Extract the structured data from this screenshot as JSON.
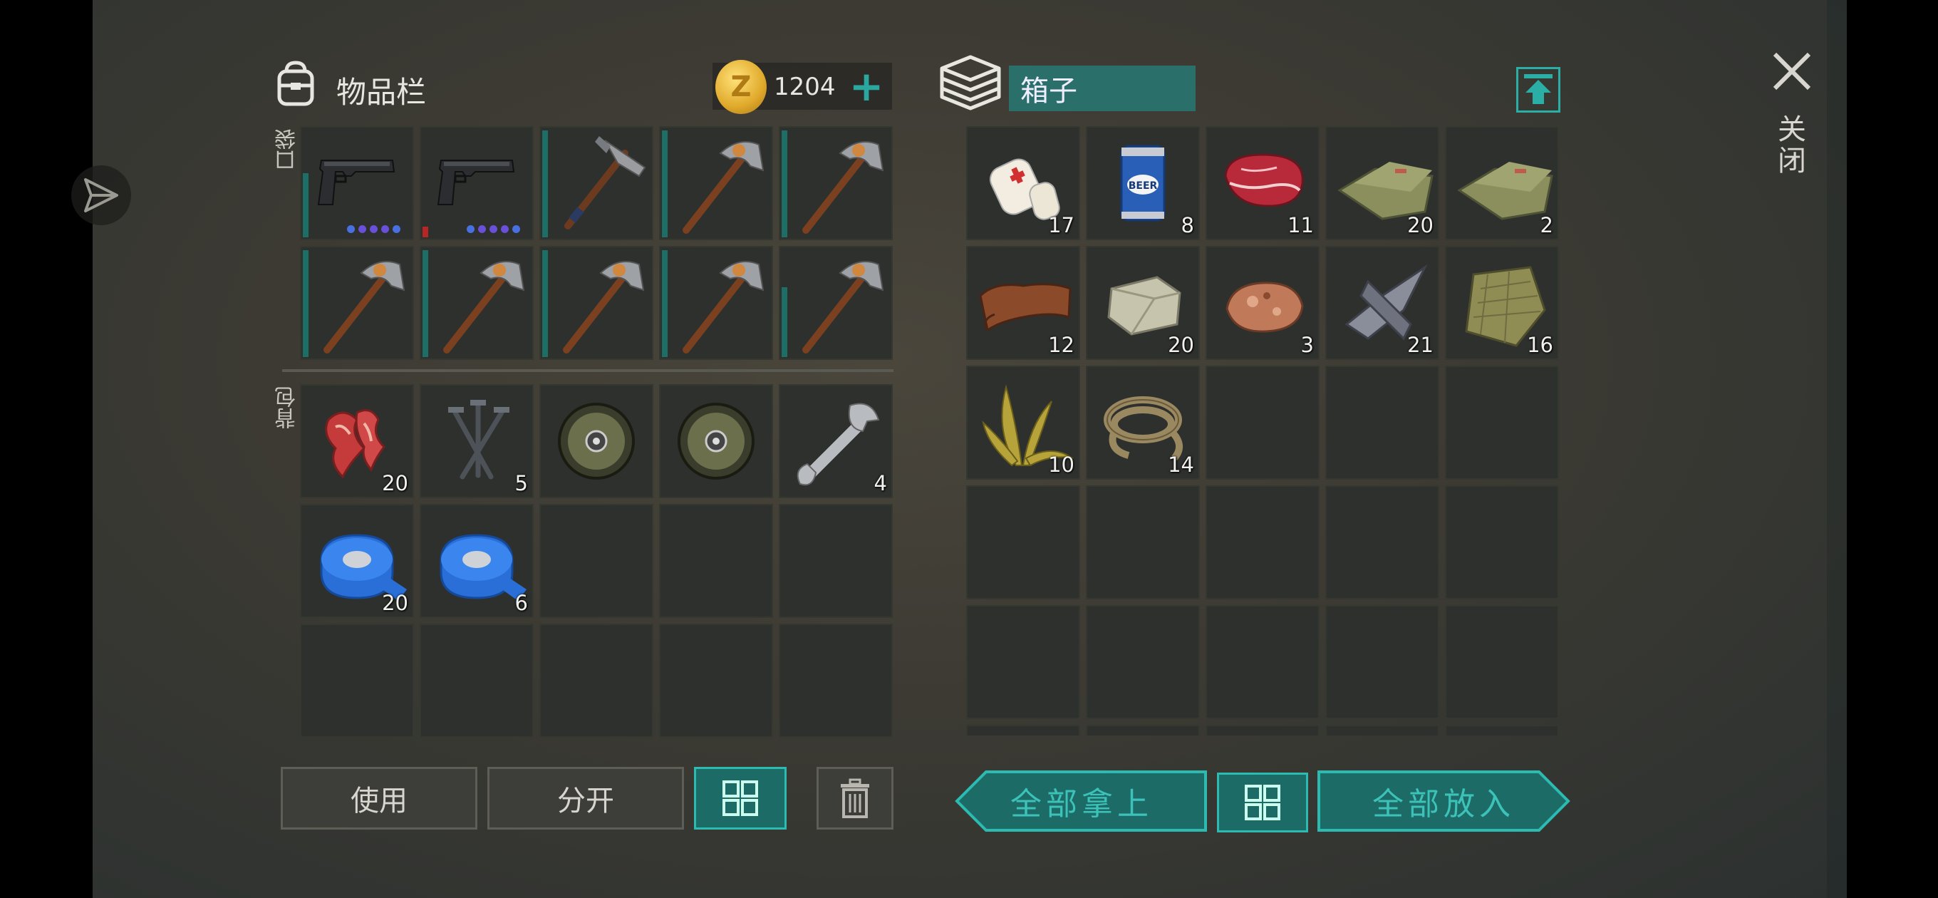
{
  "inventory": {
    "title": "物品栏",
    "coins": "1204",
    "coin_symbol": "Z",
    "add_label": "+",
    "pockets_label": "口袋",
    "backpack_label": "背包",
    "pocket_slots": [
      {
        "item": "pistol",
        "count": "",
        "dura": 0.6,
        "dura_color": "teal",
        "dots": true
      },
      {
        "item": "pistol",
        "count": "",
        "dura": 0.1,
        "dura_color": "red",
        "dots": true
      },
      {
        "item": "axe",
        "count": "",
        "dura": 1.0,
        "dura_color": "teal"
      },
      {
        "item": "pickaxe",
        "count": "",
        "dura": 1.0,
        "dura_color": "teal"
      },
      {
        "item": "pickaxe",
        "count": "",
        "dura": 1.0,
        "dura_color": "teal"
      },
      {
        "item": "pickaxe",
        "count": "",
        "dura": 1.0,
        "dura_color": "teal"
      },
      {
        "item": "pickaxe",
        "count": "",
        "dura": 1.0,
        "dura_color": "teal"
      },
      {
        "item": "pickaxe",
        "count": "",
        "dura": 1.0,
        "dura_color": "teal"
      },
      {
        "item": "pickaxe",
        "count": "",
        "dura": 1.0,
        "dura_color": "teal"
      },
      {
        "item": "pickaxe",
        "count": "",
        "dura": 0.65,
        "dura_color": "teal"
      }
    ],
    "backpack_slots": [
      {
        "item": "bacon",
        "count": "20"
      },
      {
        "item": "nails",
        "count": "5"
      },
      {
        "item": "wheel",
        "count": ""
      },
      {
        "item": "wheel",
        "count": ""
      },
      {
        "item": "wrench",
        "count": "4"
      },
      {
        "item": "tape",
        "count": "20"
      },
      {
        "item": "tape",
        "count": "6"
      },
      {
        "item": "",
        "count": ""
      },
      {
        "item": "",
        "count": ""
      },
      {
        "item": "",
        "count": ""
      },
      {
        "item": "",
        "count": ""
      },
      {
        "item": "",
        "count": ""
      },
      {
        "item": "",
        "count": ""
      },
      {
        "item": "",
        "count": ""
      },
      {
        "item": "",
        "count": ""
      }
    ],
    "buttons": {
      "use": "使用",
      "split": "分开"
    }
  },
  "box": {
    "name": "箱子",
    "slots": [
      {
        "item": "bandage",
        "count": "17"
      },
      {
        "item": "beer",
        "count": "8"
      },
      {
        "item": "steak",
        "count": "11"
      },
      {
        "item": "cloth",
        "count": "20"
      },
      {
        "item": "cloth",
        "count": "2"
      },
      {
        "item": "leather",
        "count": "12"
      },
      {
        "item": "stone",
        "count": "20"
      },
      {
        "item": "ore",
        "count": "3"
      },
      {
        "item": "scrap",
        "count": "21"
      },
      {
        "item": "burlap",
        "count": "16"
      },
      {
        "item": "plant",
        "count": "10"
      },
      {
        "item": "rope",
        "count": "14"
      },
      {
        "item": "",
        "count": ""
      },
      {
        "item": "",
        "count": ""
      },
      {
        "item": "",
        "count": ""
      },
      {
        "item": "",
        "count": ""
      },
      {
        "item": "",
        "count": ""
      },
      {
        "item": "",
        "count": ""
      },
      {
        "item": "",
        "count": ""
      },
      {
        "item": "",
        "count": ""
      },
      {
        "item": "",
        "count": ""
      },
      {
        "item": "",
        "count": ""
      },
      {
        "item": "",
        "count": ""
      },
      {
        "item": "",
        "count": ""
      },
      {
        "item": "",
        "count": ""
      },
      {
        "item": "",
        "count": ""
      },
      {
        "item": "",
        "count": ""
      },
      {
        "item": "",
        "count": ""
      },
      {
        "item": "",
        "count": ""
      },
      {
        "item": "",
        "count": ""
      }
    ],
    "buttons": {
      "take_all": "全部拿上",
      "put_all": "全部放入"
    }
  },
  "close_label": "关闭",
  "colors": {
    "accent": "#2aa8a0",
    "slot": "#2d302c"
  }
}
